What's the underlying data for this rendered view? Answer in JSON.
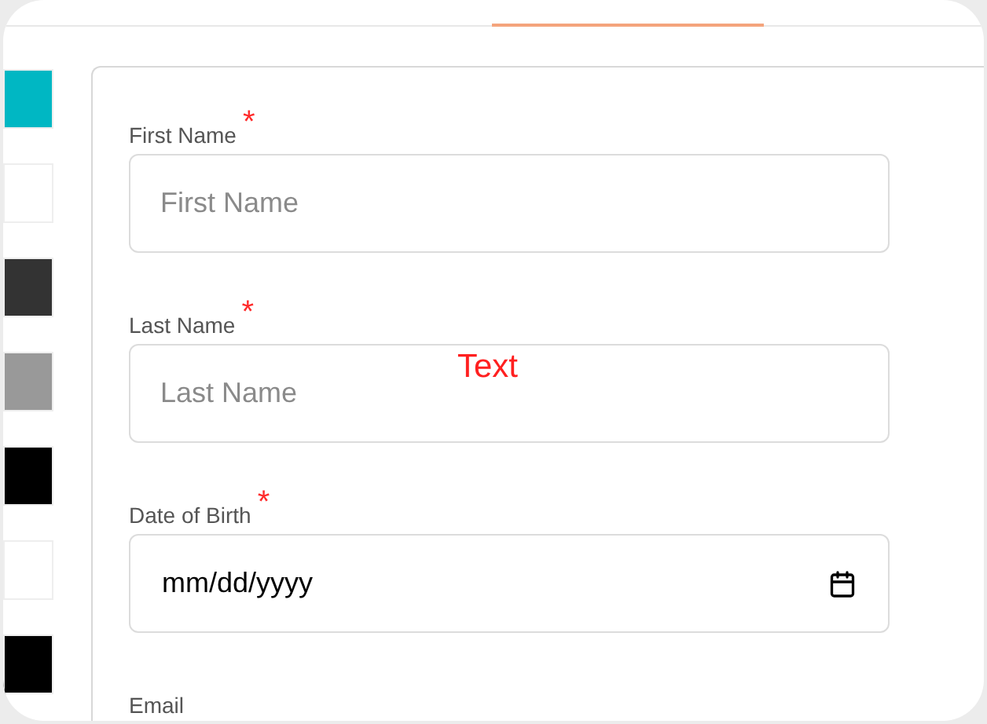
{
  "swatches": [
    {
      "color": "#00b7c3"
    },
    {
      "color": "#ffffff"
    },
    {
      "color": "#333333"
    },
    {
      "color": "#999999"
    },
    {
      "color": "#000000"
    },
    {
      "color": "#ffffff"
    },
    {
      "color": "#000000"
    }
  ],
  "fields": [
    {
      "kind": "text",
      "label": "First Name",
      "required_mark": "*",
      "placeholder": "First Name"
    },
    {
      "kind": "text",
      "label": "Last Name",
      "required_mark": "*",
      "placeholder": "Last Name"
    },
    {
      "kind": "date",
      "label": "Date of Birth",
      "required_mark": "*",
      "value": "mm/dd/yyyy"
    },
    {
      "kind": "label",
      "label": "Email"
    }
  ],
  "overlay_text": "Text"
}
